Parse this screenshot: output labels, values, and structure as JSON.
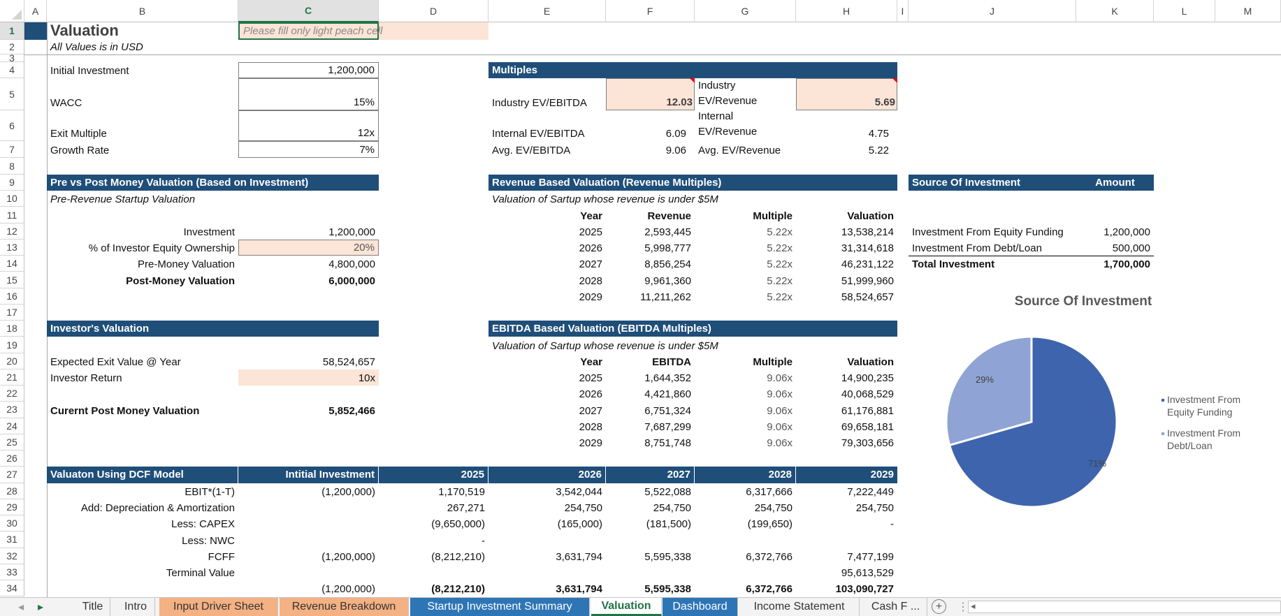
{
  "grid": {
    "column_headers": [
      "A",
      "B",
      "C",
      "D",
      "E",
      "F",
      "G",
      "H",
      "I",
      "J",
      "K",
      "L",
      "M"
    ],
    "row_numbers": [
      "1",
      "2",
      "3",
      "4",
      "5",
      "6",
      "7",
      "8",
      "9",
      "10",
      "11",
      "12",
      "13",
      "14",
      "15",
      "16",
      "17",
      "18",
      "19",
      "20",
      "21",
      "22",
      "23",
      "24",
      "25",
      "26",
      "27",
      "28",
      "29",
      "30",
      "31",
      "32",
      "33",
      "34"
    ],
    "selected_column": "C",
    "selected_row": "1"
  },
  "header": {
    "title": "Valuation",
    "subtitle": "All Values is in USD",
    "note": "Please fill only light peach cell"
  },
  "inputs": [
    {
      "label": "Initial Investment",
      "value": "1,200,000"
    },
    {
      "label": "WACC",
      "value": "15%"
    },
    {
      "label": "Exit Multiple",
      "value": "12x"
    },
    {
      "label": "Growth Rate",
      "value": "7%"
    }
  ],
  "multiples": {
    "title": "Multiples",
    "rows": [
      {
        "ebitda_label": "Industry EV/EBITDA",
        "ebitda_value": "12.03",
        "revenue_label": "Industry EV/Revenue",
        "revenue_value": "5.69"
      },
      {
        "ebitda_label": "Internal EV/EBITDA",
        "ebitda_value": "6.09",
        "revenue_label": "Internal EV/Revenue",
        "revenue_value": "4.75"
      },
      {
        "ebitda_label": "Avg. EV/EBITDA",
        "ebitda_value": "9.06",
        "revenue_label": "Avg. EV/Revenue",
        "revenue_value": "5.22"
      }
    ]
  },
  "pre_post": {
    "title": "Pre vs Post Money Valuation (Based on Investment)",
    "subtitle": "Pre-Revenue Startup Valuation",
    "rows": [
      {
        "label": "Investment",
        "value": "1,200,000"
      },
      {
        "label": "% of Investor Equity Ownership",
        "value": "20%"
      },
      {
        "label": "Pre-Money Valuation",
        "value": "4,800,000"
      },
      {
        "label": "Post-Money Valuation",
        "value": "6,000,000"
      }
    ]
  },
  "investor": {
    "title": "Investor's Valuation",
    "rows": [
      {
        "label": "Expected Exit Value @ Year",
        "value": "58,524,657"
      },
      {
        "label": "Investor Return",
        "value": "10x"
      },
      {
        "label": "Curernt Post Money Valuation",
        "value": "5,852,466"
      }
    ]
  },
  "revenue_valuation": {
    "title": "Revenue Based Valuation (Revenue Multiples)",
    "subtitle": "Valuation of Sartup whose revenue is under $5M",
    "headers": [
      "Year",
      "Revenue",
      "Multiple",
      "Valuation"
    ],
    "rows": [
      [
        "2025",
        "2,593,445",
        "5.22x",
        "13,538,214"
      ],
      [
        "2026",
        "5,998,777",
        "5.22x",
        "31,314,618"
      ],
      [
        "2027",
        "8,856,254",
        "5.22x",
        "46,231,122"
      ],
      [
        "2028",
        "9,961,360",
        "5.22x",
        "51,999,960"
      ],
      [
        "2029",
        "11,211,262",
        "5.22x",
        "58,524,657"
      ]
    ]
  },
  "ebitda_valuation": {
    "title": "EBITDA Based Valuation (EBITDA Multiples)",
    "subtitle": "Valuation of Sartup whose revenue is under $5M",
    "headers": [
      "Year",
      "EBITDA",
      "Multiple",
      "Valuation"
    ],
    "rows": [
      [
        "2025",
        "1,644,352",
        "9.06x",
        "14,900,235"
      ],
      [
        "2026",
        "4,421,860",
        "9.06x",
        "40,068,529"
      ],
      [
        "2027",
        "6,751,324",
        "9.06x",
        "61,176,881"
      ],
      [
        "2028",
        "7,687,299",
        "9.06x",
        "69,658,181"
      ],
      [
        "2029",
        "8,751,748",
        "9.06x",
        "79,303,656"
      ]
    ]
  },
  "source": {
    "title": "Source Of Investment",
    "amount_header": "Amount",
    "rows": [
      {
        "label": "Investment From Equity Funding",
        "value": "1,200,000"
      },
      {
        "label": "Investment From Debt/Loan",
        "value": "500,000"
      }
    ],
    "total": {
      "label": "Total Investment",
      "value": "1,700,000"
    }
  },
  "dcf": {
    "title": "Valuaton Using DCF Model",
    "headers": [
      "Intitial Investment",
      "2025",
      "2026",
      "2027",
      "2028",
      "2029"
    ],
    "rows": [
      {
        "label": "EBIT*(1-T)",
        "values": [
          "(1,200,000)",
          "1,170,519",
          "3,542,044",
          "5,522,088",
          "6,317,666",
          "7,222,449"
        ]
      },
      {
        "label": "Add: Depreciation & Amortization",
        "values": [
          "",
          "267,271",
          "254,750",
          "254,750",
          "254,750",
          "254,750"
        ]
      },
      {
        "label": "Less: CAPEX",
        "values": [
          "",
          "(9,650,000)",
          "(165,000)",
          "(181,500)",
          "(199,650)",
          "-"
        ]
      },
      {
        "label": "Less: NWC",
        "values": [
          "",
          "-",
          "",
          "",
          "",
          ""
        ]
      },
      {
        "label": "FCFF",
        "values": [
          "(1,200,000)",
          "(8,212,210)",
          "3,631,794",
          "5,595,338",
          "6,372,766",
          "7,477,199"
        ]
      },
      {
        "label": "Terminal Value",
        "values": [
          "",
          "",
          "",
          "",
          "",
          "95,613,529"
        ]
      },
      {
        "label": "",
        "values": [
          "(1,200,000)",
          "(8,212,210)",
          "3,631,794",
          "5,595,338",
          "6,372,766",
          "103,090,727"
        ]
      }
    ]
  },
  "chart_data": {
    "type": "pie",
    "title": "Source Of Investment",
    "categories": [
      "Investment From Equity Funding",
      "Investment From Debt/Loan"
    ],
    "values": [
      1200000,
      500000
    ],
    "data_labels": [
      "71%",
      "29%"
    ],
    "colors": [
      "#3e64ad",
      "#8fa3d4"
    ],
    "legend": "right"
  },
  "colors": {
    "header_fill": "#1f4e79",
    "input_fill": "#fce4d6",
    "selection": "#217346"
  },
  "tabs": [
    {
      "label": "Title",
      "color": ""
    },
    {
      "label": "Intro",
      "color": ""
    },
    {
      "label": "Input Driver Sheet",
      "color": "#f4b183"
    },
    {
      "label": "Revenue Breakdown",
      "color": "#f4b183"
    },
    {
      "label": "Startup Investment Summary",
      "color": "#2e75b6"
    },
    {
      "label": "Valuation",
      "color": "",
      "active": true
    },
    {
      "label": "Dashboard",
      "color": "#2e75b6"
    },
    {
      "label": "Income Statement",
      "color": ""
    },
    {
      "label": "Cash F ...",
      "color": ""
    }
  ],
  "tabbar": {
    "add_sheet": "+",
    "more": "⋮",
    "prev": "◂",
    "next": "▸"
  }
}
